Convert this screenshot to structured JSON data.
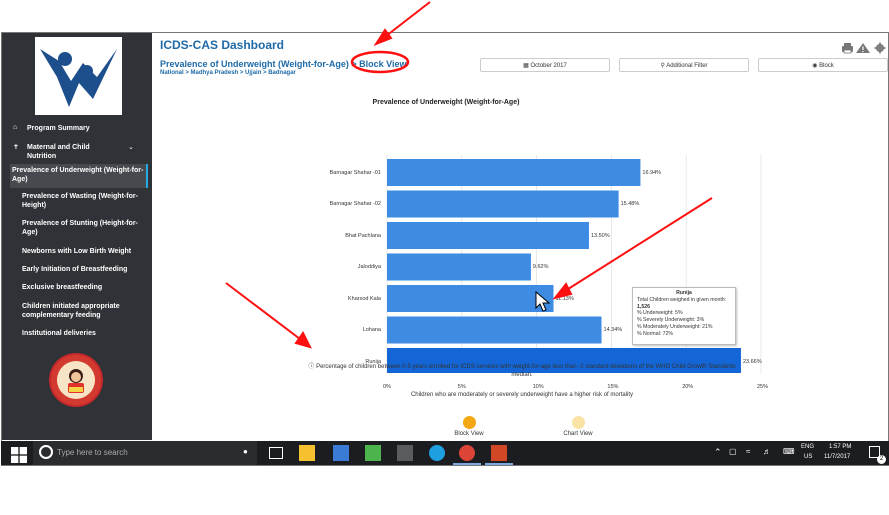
{
  "header": {
    "title": "ICDS-CAS Dashboard",
    "subtitle_main": "Prevalence of Underweight (Weight-for-Age)",
    "subtitle_sep": ">",
    "subtitle_view": "Block View",
    "breadcrumb": "National > Madhya Pradesh > Ujjain > Badnagar"
  },
  "toolbar": {
    "date_label": "October 2017",
    "filter_label": "Additional Filter",
    "block_label": "Block",
    "icons": [
      "print-icon",
      "warning-icon",
      "settings-icon"
    ]
  },
  "sidebar": {
    "items": [
      {
        "label": "Program Summary"
      },
      {
        "label": "Maternal and Child Nutrition"
      },
      {
        "label": "Prevalence of Underweight (Weight-for-Age)"
      },
      {
        "label": "Prevalence of Wasting (Weight-for-Height)"
      },
      {
        "label": "Prevalence of Stunting (Height-for-Age)"
      },
      {
        "label": "Newborns with Low Birth Weight"
      },
      {
        "label": "Early Initiation of Breastfeeding"
      },
      {
        "label": "Exclusive breastfeeding"
      },
      {
        "label": "Children initiated appropriate complementary feeding"
      },
      {
        "label": "Institutional deliveries"
      }
    ]
  },
  "chart_data": {
    "type": "bar",
    "orientation": "horizontal",
    "title": "Prevalence of Underweight (Weight-for-Age)",
    "categories": [
      "Barnagar Shahar -01",
      "Barnagar Shahar -02",
      "Bhat Pachlana",
      "Jaloddiya",
      "Kharsod Kala",
      "Lohana",
      "Runija"
    ],
    "values": [
      16.94,
      15.48,
      13.5,
      9.62,
      11.13,
      14.34,
      23.66
    ],
    "value_labels": [
      "16.94%",
      "15.48%",
      "13.50%",
      "9.62%",
      "11.13%",
      "14.34%",
      "23.66%"
    ],
    "x_ticks": [
      "0%",
      "5%",
      "10%",
      "15%",
      "20%",
      "25%"
    ],
    "xlim": [
      0,
      25
    ],
    "grid": true,
    "colors": {
      "bar": "#3d8be3",
      "bar_highlight": "#1466d6"
    },
    "tooltip": {
      "title": "Runija",
      "line1": "Total Children weighed in given month:",
      "line1_value": "1,526",
      "lines": [
        "% Underweight: 5%",
        "% Severely Underweight: 3%",
        "% Moderately Underweight: 21%",
        "% Normal: 72%"
      ]
    }
  },
  "notes": {
    "info": "Percentage of children between 0-5 years enrolled for ICDS services with weight-for-age less than -2 standard deviations of the WHO Child Growth Standards median.",
    "risk": "Children who are moderately or severely underweight have a higher risk of mortality",
    "block_view": "Block View",
    "chart_view": "Chart View"
  },
  "taskbar": {
    "search_placeholder": "Type here to search",
    "lang1": "ENG",
    "lang2": "US",
    "time": "1:57 PM",
    "date": "11/7/2017",
    "notif_count": "2"
  }
}
